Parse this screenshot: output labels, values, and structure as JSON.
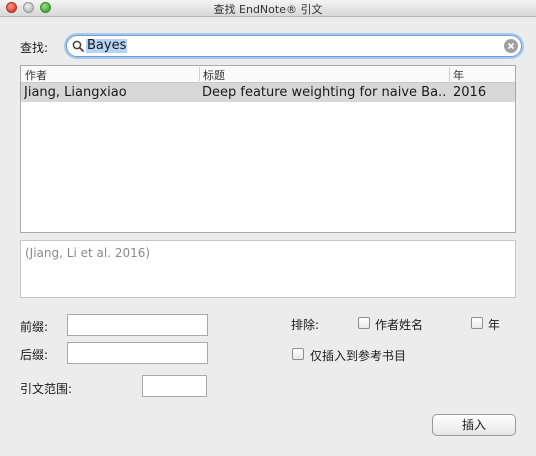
{
  "window": {
    "title": "查找 EndNote® 引文"
  },
  "search": {
    "label": "查找:",
    "value": "Bayes"
  },
  "table": {
    "columns": [
      "作者",
      "标题",
      "年"
    ],
    "rows": [
      {
        "author": "Jiang, Liangxiao",
        "title": "Deep feature weighting for naive Ba...",
        "year": "2016"
      }
    ]
  },
  "preview": {
    "text": "(Jiang, Li et al. 2016)"
  },
  "form": {
    "prefix_label": "前缀:",
    "suffix_label": "后缀:",
    "pages_label": "引文范围:",
    "prefix_value": "",
    "suffix_value": "",
    "pages_value": ""
  },
  "exclude": {
    "label": "排除:",
    "author_label": "作者姓名",
    "year_label": "年",
    "bib_only_label": "仅插入到参考书目",
    "author_checked": false,
    "year_checked": false,
    "bib_only_checked": false
  },
  "actions": {
    "insert_label": "插入"
  },
  "colors": {
    "selection": "#b5d3f5",
    "focus_ring": "#a9c8ee",
    "row_selected": "#d7d7d7"
  }
}
